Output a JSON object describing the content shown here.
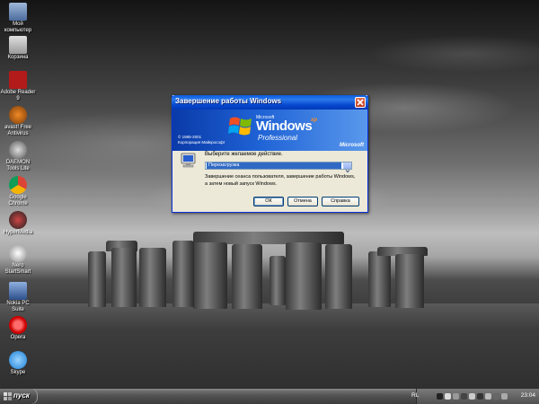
{
  "desktop": {
    "icons": [
      {
        "label": "Мой компьютер"
      },
      {
        "label": "Корзина"
      },
      {
        "label": "Adobe Reader 9"
      },
      {
        "label": "avast! Free Antivirus"
      },
      {
        "label": "DAEMON Tools Lite"
      },
      {
        "label": "Google Chrome"
      },
      {
        "label": "HyperMedia"
      },
      {
        "label": "Nero StartSmart"
      },
      {
        "label": "Nokia PC Suite"
      },
      {
        "label": "Opera"
      },
      {
        "label": "Skype"
      }
    ]
  },
  "dialog": {
    "title": "Завершение работы Windows",
    "banner": {
      "copyright_line1": "© 1985-2001",
      "copyright_line2": "Корпорация Майкрософт",
      "brand_small": "Microsoft",
      "brand_windows": "Windows",
      "brand_xp": "xp",
      "brand_edition": "Professional",
      "brand_ms": "Microsoft"
    },
    "prompt": "Выберите желаемое действие.",
    "selected_action": "Перезагрузка",
    "description": "Завершение сеанса пользователя, завершение работы Windows, а затем новый запуск Windows.",
    "buttons": {
      "ok": "ОК",
      "cancel": "Отмена",
      "help": "Справка"
    }
  },
  "taskbar": {
    "start_label": "пуск",
    "language": "RL",
    "clock": "23:04"
  },
  "colors": {
    "titlebar_blue": "#0a5ddf",
    "dialog_face": "#ece9d8",
    "selection": "#316ac5"
  }
}
